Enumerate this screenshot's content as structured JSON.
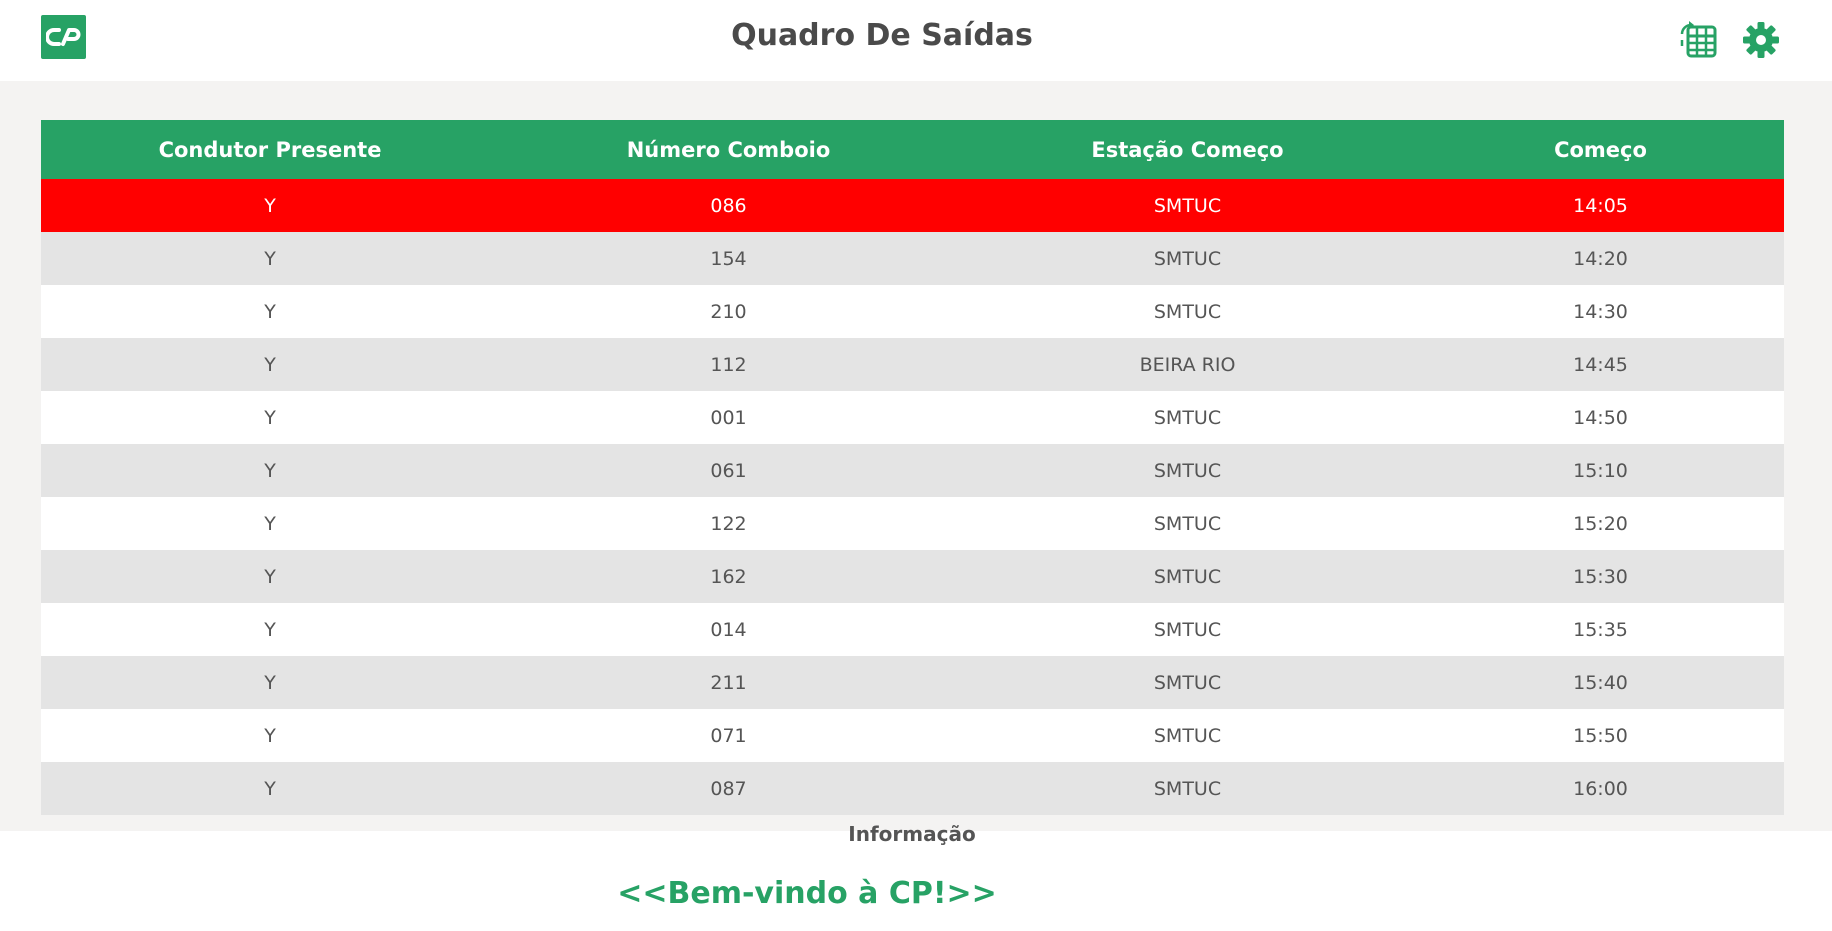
{
  "header": {
    "title": "Quadro De Saídas",
    "logo_text": "CP",
    "icons": [
      "cp-logo-icon",
      "table-refresh-icon",
      "gear-icon"
    ]
  },
  "colors": {
    "brand": "#27a265",
    "alert_row": "#ff0000",
    "stripe": "#e4e4e4",
    "title_text": "#4a4a4a"
  },
  "table": {
    "headers": [
      "Condutor Presente",
      "Número Comboio",
      "Estação Começo",
      "Começo"
    ],
    "rows": [
      {
        "condutor": "Y",
        "numero": "086",
        "estacao": "SMTUC",
        "comeco": "14:05",
        "alert": true
      },
      {
        "condutor": "Y",
        "numero": "154",
        "estacao": "SMTUC",
        "comeco": "14:20"
      },
      {
        "condutor": "Y",
        "numero": "210",
        "estacao": "SMTUC",
        "comeco": "14:30"
      },
      {
        "condutor": "Y",
        "numero": "112",
        "estacao": "BEIRA RIO",
        "comeco": "14:45"
      },
      {
        "condutor": "Y",
        "numero": "001",
        "estacao": "SMTUC",
        "comeco": "14:50"
      },
      {
        "condutor": "Y",
        "numero": "061",
        "estacao": "SMTUC",
        "comeco": "15:10"
      },
      {
        "condutor": "Y",
        "numero": "122",
        "estacao": "SMTUC",
        "comeco": "15:20"
      },
      {
        "condutor": "Y",
        "numero": "162",
        "estacao": "SMTUC",
        "comeco": "15:30"
      },
      {
        "condutor": "Y",
        "numero": "014",
        "estacao": "SMTUC",
        "comeco": "15:35"
      },
      {
        "condutor": "Y",
        "numero": "211",
        "estacao": "SMTUC",
        "comeco": "15:40"
      },
      {
        "condutor": "Y",
        "numero": "071",
        "estacao": "SMTUC",
        "comeco": "15:50"
      },
      {
        "condutor": "Y",
        "numero": "087",
        "estacao": "SMTUC",
        "comeco": "16:00"
      }
    ]
  },
  "footer": {
    "info_label": "Informação",
    "welcome": "<<Bem-vindo à CP!>>"
  }
}
